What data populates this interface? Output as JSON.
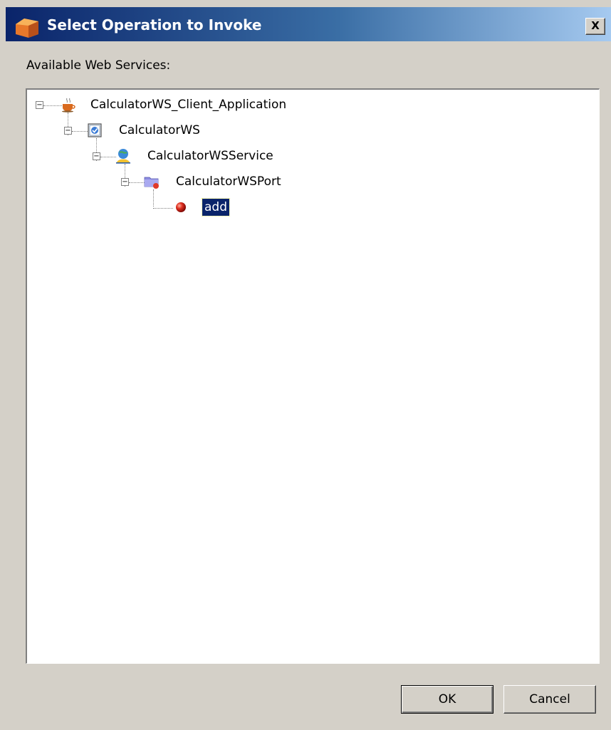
{
  "window": {
    "title": "Select Operation to Invoke",
    "close_label": "X"
  },
  "section_label": "Available Web Services:",
  "tree": {
    "nodes": [
      {
        "label": "CalculatorWS_Client_Application",
        "icon": "coffee-cup-icon",
        "expanded": true
      },
      {
        "label": "CalculatorWS",
        "icon": "web-service-icon",
        "expanded": true
      },
      {
        "label": "CalculatorWSService",
        "icon": "globe-user-icon",
        "expanded": true
      },
      {
        "label": "CalculatorWSPort",
        "icon": "folder-port-icon",
        "expanded": true
      },
      {
        "label": "add",
        "icon": "red-ball-operation-icon",
        "selected": true
      }
    ],
    "expander_symbol": "−"
  },
  "buttons": {
    "ok": "OK",
    "cancel": "Cancel"
  },
  "colors": {
    "titlebar_start": "#0a246a",
    "titlebar_end": "#a6caf0",
    "selection": "#0a246a",
    "dialog_bg": "#d4d0c8"
  }
}
